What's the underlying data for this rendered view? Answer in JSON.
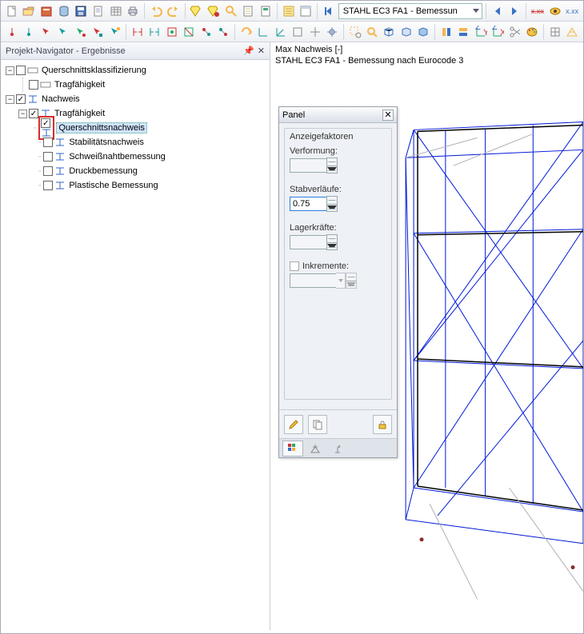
{
  "toolbar": {
    "combo_value": "STAHL EC3 FA1 - Bemessun",
    "xx_label": "x.xx",
    "xx_strike": "x.xx"
  },
  "navigator": {
    "title": "Projekt-Navigator - Ergebnisse"
  },
  "tree": {
    "n1": "Querschnittsklassifizierung",
    "n2": "Tragfähigkeit",
    "n3": "Nachweis",
    "n4": "Tragfähigkeit",
    "n5": "Querschnittsnachweis",
    "n6": "Stabilitätsnachweis",
    "n7": "Schweißnahtbemessung",
    "n8": "Druckbemessung",
    "n9": "Plastische Bemessung"
  },
  "viewport": {
    "line1": "Max Nachweis [-]",
    "line2": "STAHL EC3 FA1 - Bemessung nach Eurocode 3"
  },
  "panel": {
    "title": "Panel",
    "group_title": "Anzeigefaktoren",
    "verformung_label": "Verformung:",
    "verformung_value": "",
    "stab_label": "Stabverläufe:",
    "stab_value": "0.75",
    "lager_label": "Lagerkräfte:",
    "lager_value": "",
    "inkr_label": "Inkremente:"
  }
}
